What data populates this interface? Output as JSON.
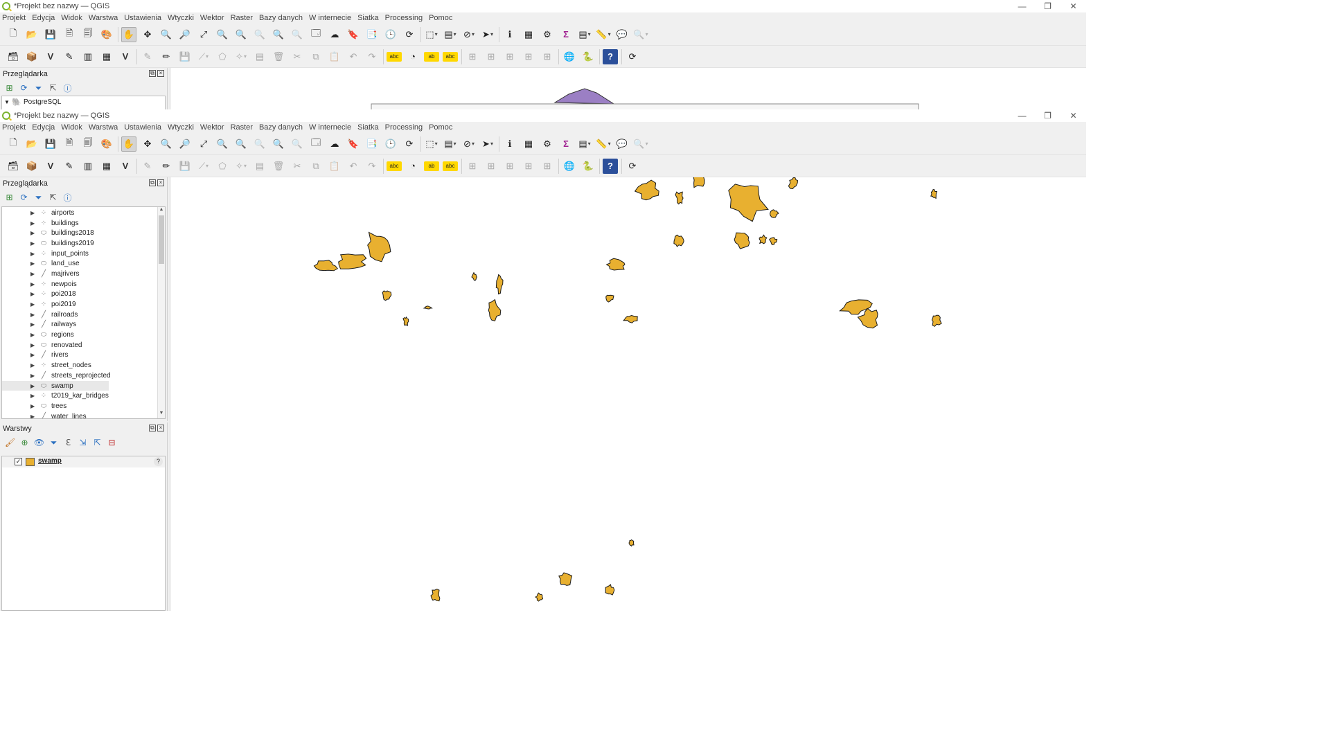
{
  "window_title": "*Projekt bez nazwy — QGIS",
  "window_controls": {
    "minimize": "—",
    "maximize": "❐",
    "close": "✕"
  },
  "menu": [
    "Projekt",
    "Edycja",
    "Widok",
    "Warstwa",
    "Ustawienia",
    "Wtyczki",
    "Wektor",
    "Raster",
    "Bazy danych",
    "W internecie",
    "Siatka",
    "Processing",
    "Pomoc"
  ],
  "browser_panel": {
    "title": "Przeglądarka",
    "back_item": "PostgreSQL",
    "layers": [
      {
        "name": "airports",
        "geom": "point"
      },
      {
        "name": "buildings",
        "geom": "point"
      },
      {
        "name": "buildings2018",
        "geom": "polygon"
      },
      {
        "name": "buildings2019",
        "geom": "polygon"
      },
      {
        "name": "input_points",
        "geom": "point"
      },
      {
        "name": "land_use",
        "geom": "polygon"
      },
      {
        "name": "majrivers",
        "geom": "line"
      },
      {
        "name": "newpois",
        "geom": "point"
      },
      {
        "name": "poi2018",
        "geom": "point"
      },
      {
        "name": "poi2019",
        "geom": "point"
      },
      {
        "name": "railroads",
        "geom": "line"
      },
      {
        "name": "railways",
        "geom": "line"
      },
      {
        "name": "regions",
        "geom": "polygon"
      },
      {
        "name": "renovated",
        "geom": "polygon"
      },
      {
        "name": "rivers",
        "geom": "line"
      },
      {
        "name": "street_nodes",
        "geom": "point"
      },
      {
        "name": "streets_reprojected",
        "geom": "line"
      },
      {
        "name": "swamp",
        "geom": "polygon",
        "selected": true
      },
      {
        "name": "t2019_kar_bridges",
        "geom": "point"
      },
      {
        "name": "trees",
        "geom": "polygon"
      },
      {
        "name": "water_lines",
        "geom": "line"
      }
    ]
  },
  "layers_panel": {
    "title": "Warstwy",
    "items": [
      {
        "name": "swamp",
        "checked": true,
        "color": "#e8b030",
        "badge": "?"
      }
    ]
  },
  "colors": {
    "swamp_fill": "#e8b030",
    "swamp_stroke": "#1a1a1a",
    "back_map_feature": "#9b7fc4"
  }
}
